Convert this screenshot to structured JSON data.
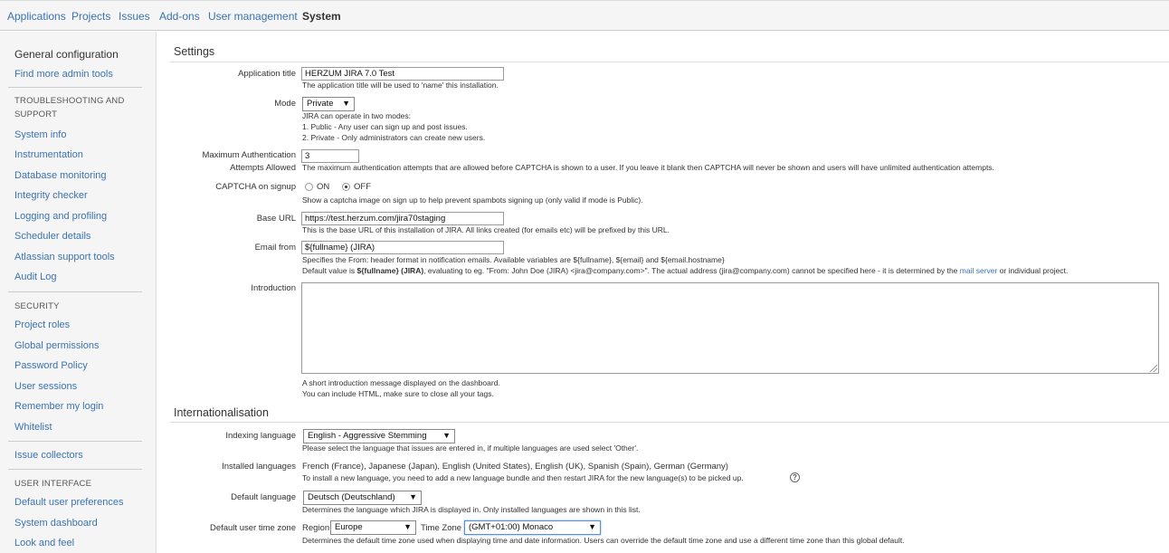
{
  "topnav": {
    "items": [
      "Applications",
      "Projects",
      "Issues",
      "Add-ons",
      "User management",
      "System"
    ]
  },
  "sidebar": {
    "general_configuration": "General configuration",
    "find_more_admin_tools": "Find more admin tools",
    "troubleshooting_heading": "TROUBLESHOOTING AND SUPPORT",
    "troubleshooting_items": [
      "System info",
      "Instrumentation",
      "Database monitoring",
      "Integrity checker",
      "Logging and profiling",
      "Scheduler details",
      "Atlassian support tools",
      "Audit Log"
    ],
    "security_heading": "SECURITY",
    "security_items": [
      "Project roles",
      "Global permissions",
      "Password Policy",
      "User sessions",
      "Remember my login",
      "Whitelist"
    ],
    "issue_collectors": "Issue collectors",
    "user_interface_heading": "USER INTERFACE",
    "user_interface_items": [
      "Default user preferences",
      "System dashboard",
      "Look and feel"
    ]
  },
  "settings": {
    "title": "Settings",
    "application_title": {
      "label": "Application title",
      "value": "HERZUM JIRA 7.0 Test",
      "desc": "The application title will be used to 'name' this installation."
    },
    "mode": {
      "label": "Mode",
      "value": "Private",
      "desc1": "JIRA can operate in two modes:",
      "desc2": "1. Public - Any user can sign up and post issues.",
      "desc3": "2. Private - Only administrators can create new users."
    },
    "max_auth": {
      "label1": "Maximum Authentication",
      "label2": "Attempts Allowed",
      "value": "3",
      "desc": "The maximum authentication attempts that are allowed before CAPTCHA is shown to a user. If you leave it blank then CAPTCHA will never be shown and users will have unlimited authentication attempts."
    },
    "captcha": {
      "label": "CAPTCHA on signup",
      "on_label": "ON",
      "off_label": "OFF",
      "desc": "Show a captcha image on sign up to help prevent spambots signing up (only valid if mode is Public)."
    },
    "base_url": {
      "label": "Base URL",
      "value": "https://test.herzum.com/jira70staging",
      "desc": "This is the base URL of this installation of JIRA. All links created (for emails etc) will be prefixed by this URL."
    },
    "email_from": {
      "label": "Email from",
      "value": "${fullname} (JIRA)",
      "desc1": "Specifies the From: header format in notification emails. Available variables are ${fullname}, ${email} and ${email.hostname}",
      "desc2_pre": "Default value is ",
      "desc2_bold": "${fullname} (JIRA)",
      "desc2_mid": ", evaluating to eg. \"From: John Doe (JIRA) <jira@company.com>\". The actual address (jira@company.com) cannot be specified here - it is determined by the ",
      "desc2_link": "mail server",
      "desc2_post": " or individual project."
    },
    "introduction": {
      "label": "Introduction",
      "value": "",
      "desc1": "A short introduction message displayed on the dashboard.",
      "desc2": "You can include HTML, make sure to close all your tags."
    }
  },
  "i18n": {
    "title": "Internationalisation",
    "indexing_language": {
      "label": "Indexing language",
      "value": "English - Aggressive Stemming",
      "desc": "Please select the language that issues are entered in, if multiple languages are used select 'Other'."
    },
    "installed_languages": {
      "label": "Installed languages",
      "value": "French (France), Japanese (Japan), English (United States), English (UK), Spanish (Spain), German (Germany)",
      "desc": "To install a new language, you need to add a new language bundle and then restart JIRA for the new language(s) to be picked up."
    },
    "default_language": {
      "label": "Default language",
      "value": "Deutsch (Deutschland)",
      "desc": "Determines the language which JIRA is displayed in. Only installed languages are shown in this list."
    },
    "time_zone": {
      "label": "Default user time zone",
      "region_label": "Region",
      "region_value": "Europe",
      "tz_label": "Time Zone",
      "tz_value": "(GMT+01:00) Monaco",
      "desc": "Determines the default time zone used when displaying time and date information. Users can override the default time zone and use a different time zone than this global default."
    }
  }
}
